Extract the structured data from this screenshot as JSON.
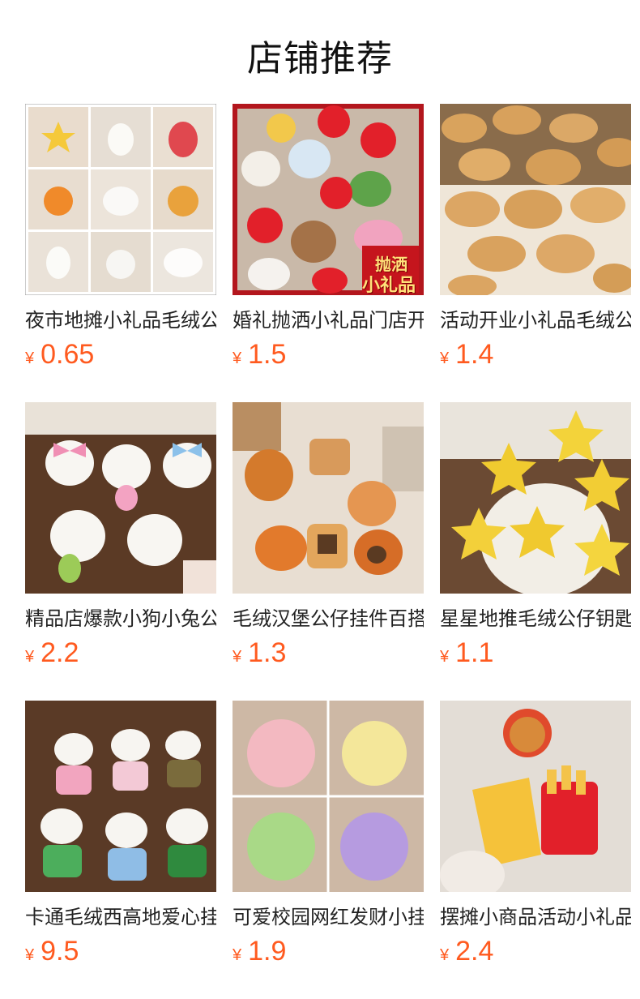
{
  "header": {
    "title": "店铺推荐"
  },
  "currency": "¥",
  "products": [
    {
      "title": "夜市地摊小礼品毛绒公仔挂件",
      "price": "0.65"
    },
    {
      "title": "婚礼抛洒小礼品门店开业",
      "price": "1.5"
    },
    {
      "title": "活动开业小礼品毛绒公仔",
      "price": "1.4"
    },
    {
      "title": "精品店爆款小狗小兔公仔挂件",
      "price": "2.2"
    },
    {
      "title": "毛绒汉堡公仔挂件百搭",
      "price": "1.3"
    },
    {
      "title": "星星地推毛绒公仔钥匙扣",
      "price": "1.1"
    },
    {
      "title": "卡通毛绒西高地爱心挂件",
      "price": "9.5"
    },
    {
      "title": "可爱校园网红发财小挂件",
      "price": "1.9"
    },
    {
      "title": "摆摊小商品活动小礼品",
      "price": "2.4"
    }
  ],
  "overlay": {
    "line1": "抛洒",
    "line2": "小礼品"
  },
  "colors": {
    "price": "#ff5a1f",
    "title": "#111111",
    "banner": "#b3161d"
  },
  "icons": [
    "plush-toy-image"
  ]
}
